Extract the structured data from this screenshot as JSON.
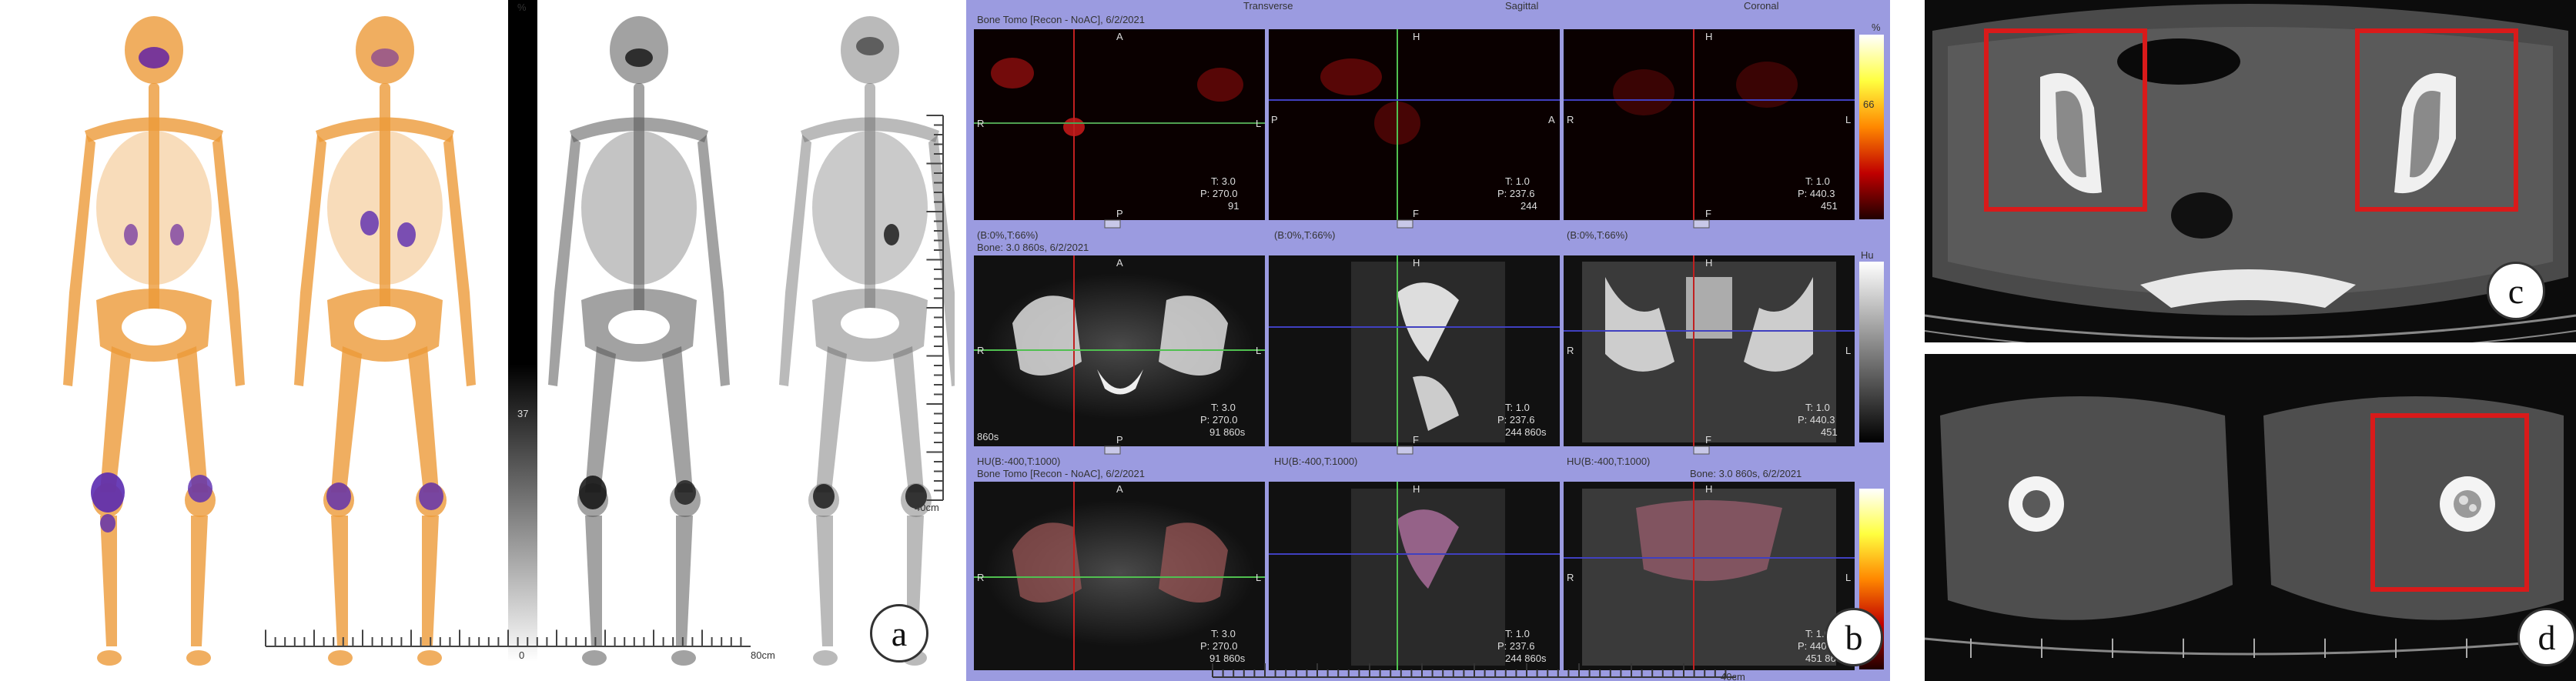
{
  "panel_a": {
    "label": "a",
    "colorbar_top": "%",
    "colorbar_mid": "37",
    "colorbar_bottom": "0",
    "ruler_unit": "80cm",
    "right_ruler_unit": "40cm"
  },
  "panel_b": {
    "label": "b",
    "view_transverse": "Transverse",
    "view_sagittal": "Sagittal",
    "view_coronal": "Coronal",
    "row1_title": "Bone Tomo [Recon - NoAC], 6/2/2021",
    "row1_pct": "%",
    "row1_max": "66",
    "row1_transverse": {
      "t": "T: 3.0",
      "p": "P: 270.0",
      "n": "91"
    },
    "row1_sagittal": {
      "t": "T: 1.0",
      "p": "P: 237.6",
      "n": "244"
    },
    "row1_coronal": {
      "t": "T: 1.0",
      "p": "P: 440.3",
      "n": "451"
    },
    "row2_win1": "(B:0%,T:66%)",
    "row2_win2": "(B:0%,T:66%)",
    "row2_win3": "(B:0%,T:66%)",
    "row2_title": "Bone: 3.0  860s, 6/2/2021",
    "row2_hu": "Hu",
    "row2_transverse": {
      "t": "T: 3.0",
      "p": "P: 270.0",
      "n": "91 860s"
    },
    "row2_sagittal": {
      "t": "T: 1.0",
      "p": "P: 237.6",
      "n": "244 860s"
    },
    "row2_coronal": {
      "t": "T: 1.0",
      "p": "P: 440.3",
      "n": "451"
    },
    "row2_time": "860s",
    "row3_win1": "HU(B:-400,T:1000)",
    "row3_win2": "HU(B:-400,T:1000)",
    "row3_win3": "HU(B:-400,T:1000)",
    "row3_title": "Bone Tomo [Recon - NoAC], 6/2/2021",
    "row3_title_right": "Bone: 3.0  860s, 6/2/2021",
    "row3_transverse": {
      "t": "T: 3.0",
      "p": "P: 270.0",
      "n": "91 860s"
    },
    "row3_sagittal": {
      "t": "T: 1.0",
      "p": "P: 237.6",
      "n": "244 860s"
    },
    "row3_coronal": {
      "t": "T: 1.0",
      "p": "P: 440.3",
      "n": "451 860s"
    },
    "ruler_unit": "40cm",
    "orient": {
      "a": "A",
      "p": "P",
      "r": "R",
      "l": "L",
      "h": "H",
      "f": "F"
    }
  },
  "panel_c": {
    "label": "c"
  },
  "panel_d": {
    "label": "d"
  },
  "colors": {
    "hot_orange": "#e8902a",
    "highlight_box": "#d91a1a",
    "ui_lavender": "#9b9be0"
  }
}
